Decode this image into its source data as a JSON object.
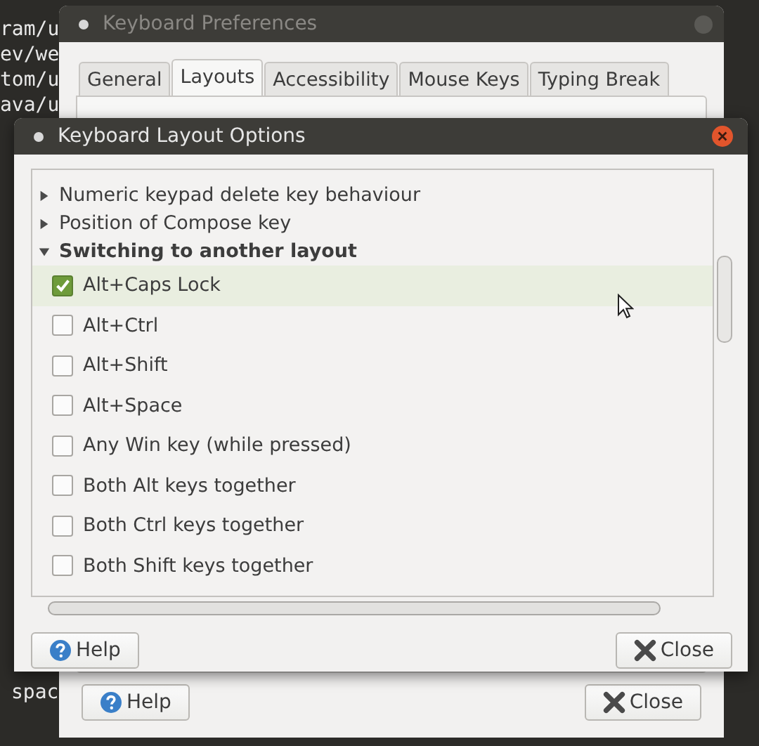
{
  "terminal": {
    "lines": [
      "ram/u",
      "ev/we",
      "tom/u",
      "ava/u",
      "spac"
    ]
  },
  "back_window": {
    "title": "Keyboard Preferences",
    "tabs": [
      {
        "label": "General",
        "selected": false
      },
      {
        "label": "Layouts",
        "selected": true
      },
      {
        "label": "Accessibility",
        "selected": false
      },
      {
        "label": "Mouse Keys",
        "selected": false
      },
      {
        "label": "Typing Break",
        "selected": false
      }
    ],
    "buttons": [
      {
        "label": "Help",
        "kind": "help"
      },
      {
        "label": "Close",
        "kind": "close"
      }
    ]
  },
  "dialog": {
    "title": "Keyboard Layout Options",
    "tree": [
      {
        "label": "Numeric keypad delete key behaviour",
        "expanded": false
      },
      {
        "label": "Position of Compose key",
        "expanded": false
      },
      {
        "label": "Switching to another layout",
        "expanded": true,
        "children": [
          {
            "label": "Alt+Caps Lock",
            "checked": true,
            "selected": true
          },
          {
            "label": "Alt+Ctrl",
            "checked": false,
            "selected": false
          },
          {
            "label": "Alt+Shift",
            "checked": false,
            "selected": false
          },
          {
            "label": "Alt+Space",
            "checked": false,
            "selected": false
          },
          {
            "label": "Any Win key (while pressed)",
            "checked": false,
            "selected": false
          },
          {
            "label": "Both Alt keys together",
            "checked": false,
            "selected": false
          },
          {
            "label": "Both Ctrl keys together",
            "checked": false,
            "selected": false
          },
          {
            "label": "Both Shift keys together",
            "checked": false,
            "selected": false
          }
        ]
      }
    ],
    "buttons": [
      {
        "label": "Help",
        "kind": "help"
      },
      {
        "label": "Close",
        "kind": "close"
      }
    ]
  }
}
